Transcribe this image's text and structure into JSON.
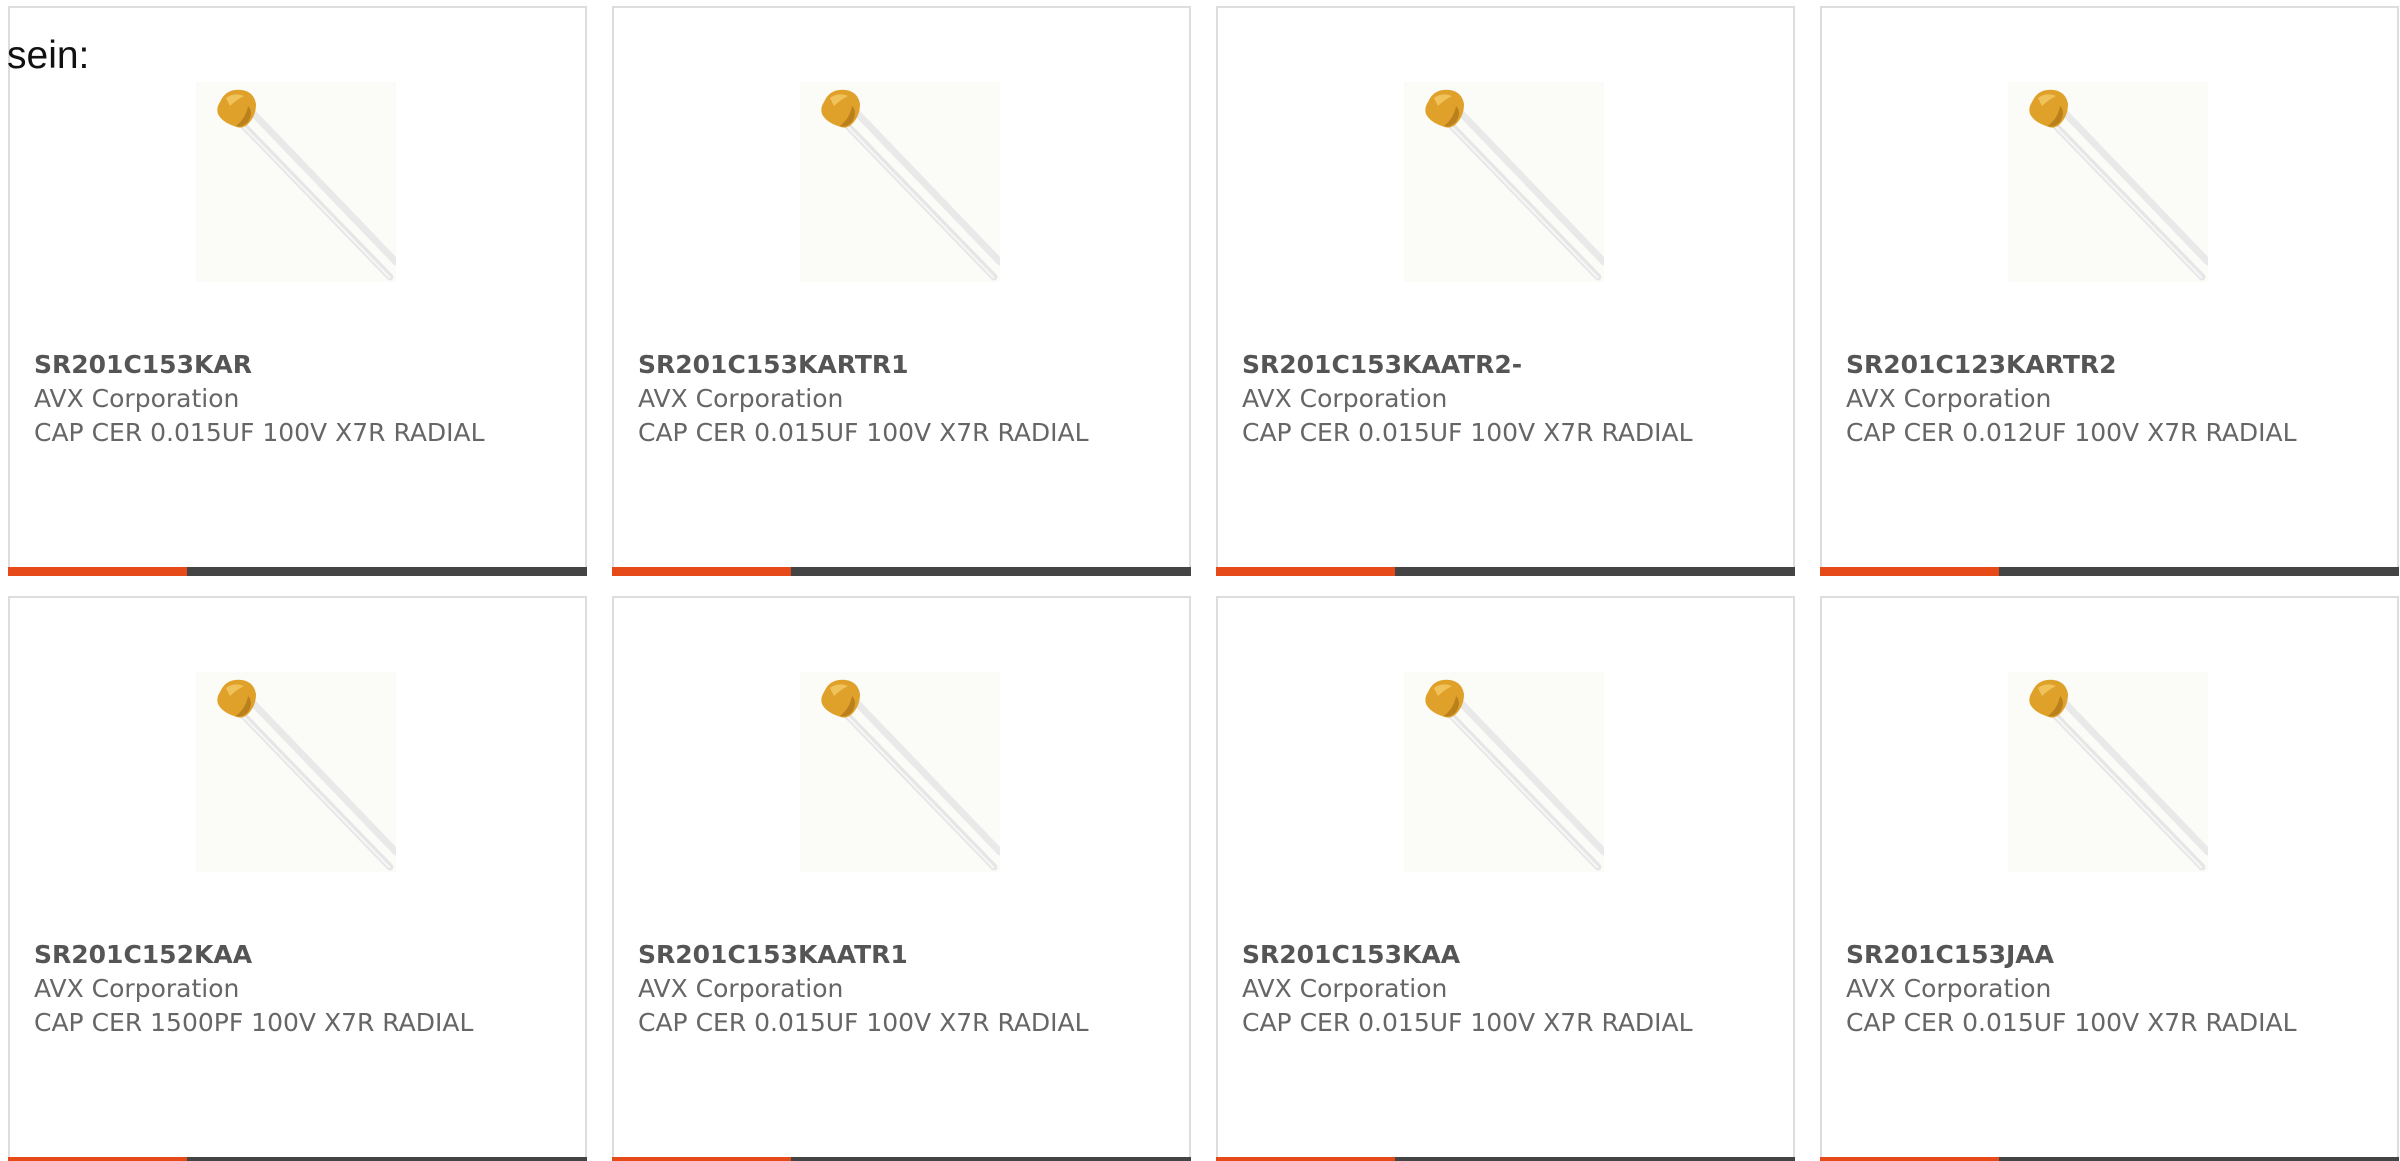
{
  "intro_text": "sein:",
  "colors": {
    "accent": "#e64a19",
    "bar": "#444444",
    "border": "#dddddd",
    "capacitor_body": "#e0a12a",
    "text": "#666666"
  },
  "cards": [
    {
      "part_number": "SR201C153KAR",
      "manufacturer": "AVX Corporation",
      "description": "CAP CER 0.015UF 100V X7R RADIAL",
      "image_icon": "ceramic-capacitor-icon"
    },
    {
      "part_number": "SR201C153KARTR1",
      "manufacturer": "AVX Corporation",
      "description": "CAP CER 0.015UF 100V X7R RADIAL",
      "image_icon": "ceramic-capacitor-icon"
    },
    {
      "part_number": "SR201C153KAATR2-",
      "manufacturer": "AVX Corporation",
      "description": "CAP CER 0.015UF 100V X7R RADIAL",
      "image_icon": "ceramic-capacitor-icon"
    },
    {
      "part_number": "SR201C123KARTR2",
      "manufacturer": "AVX Corporation",
      "description": "CAP CER 0.012UF 100V X7R RADIAL",
      "image_icon": "ceramic-capacitor-icon"
    },
    {
      "part_number": "SR201C152KAA",
      "manufacturer": "AVX Corporation",
      "description": "CAP CER 1500PF 100V X7R RADIAL",
      "image_icon": "ceramic-capacitor-icon"
    },
    {
      "part_number": "SR201C153KAATR1",
      "manufacturer": "AVX Corporation",
      "description": "CAP CER 0.015UF 100V X7R RADIAL",
      "image_icon": "ceramic-capacitor-icon"
    },
    {
      "part_number": "SR201C153KAA",
      "manufacturer": "AVX Corporation",
      "description": "CAP CER 0.015UF 100V X7R RADIAL",
      "image_icon": "ceramic-capacitor-icon"
    },
    {
      "part_number": "SR201C153JAA",
      "manufacturer": "AVX Corporation",
      "description": "CAP CER 0.015UF 100V X7R RADIAL",
      "image_icon": "ceramic-capacitor-icon"
    }
  ],
  "accent_bar_fraction": 0.31
}
